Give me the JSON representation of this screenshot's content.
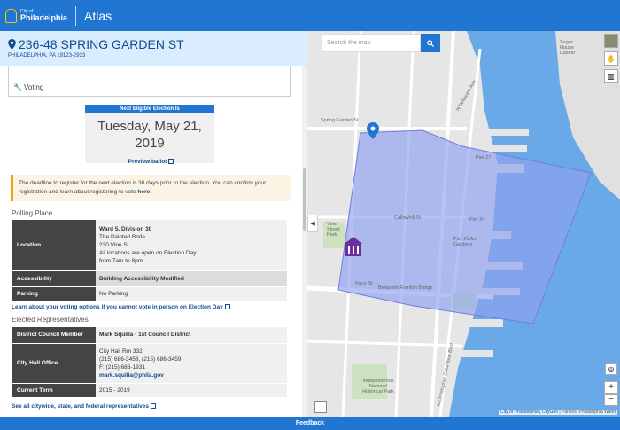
{
  "header": {
    "logo_small": "City of",
    "logo_big": "Philadelphia",
    "app_name": "Atlas"
  },
  "address": {
    "title": "236-48 SPRING GARDEN ST",
    "subtitle": "PHILADELPHIA, PA 19123-2923"
  },
  "voting": {
    "tab_label": "Voting"
  },
  "election": {
    "header": "Next Eligible Election Is",
    "date_line1": "Tuesday, May 21,",
    "date_line2": "2019",
    "preview_link": "Preview ballot"
  },
  "callout": {
    "text": "The deadline to register for the next election is 30 days prior to the election. You can confirm your registration and learn about registering to vote",
    "link": "here",
    "end": "."
  },
  "polling": {
    "title": "Polling Place",
    "location_label": "Location",
    "ward": "Ward 5, Division 30",
    "place": "The Painted Bride",
    "street": "230 Vine St",
    "hours1": "All locations are open on Election Day",
    "hours2": "from 7am to 8pm.",
    "accessibility_label": "Accessibility",
    "accessibility_value": "Building Accessibility Modified",
    "parking_label": "Parking",
    "parking_value": "No Parking",
    "options_link": "Learn about your voting options if you cannot vote in person on Election Day"
  },
  "reps": {
    "title": "Elected Representatives",
    "council_label": "District Council Member",
    "council_value": "Mark Squilla - 1st Council District",
    "office_label": "City Hall Office",
    "office_line1": "City Hall Rm 332",
    "office_line2": "(215) 686-3458, (215) 686-3459",
    "office_line3": "F: (215) 686-1931",
    "office_email": "mark.squilla@phila.gov",
    "term_label": "Current Term",
    "term_value": "2015 - 2019",
    "all_link": "See all citywide, state, and federal representatives"
  },
  "map": {
    "search_placeholder": "Search the map",
    "attribution_city": "City of Philadelphia",
    "attribution_sep": " | ",
    "attribution_cityGeo": "CityGeo",
    "attribution_rest": " | Parcels: Philadelphia Water",
    "zoom_in": "+",
    "zoom_out": "−",
    "labels": {
      "spring_garden": "Spring Garden St",
      "vine": "Vine Street Park",
      "benfranklin": "Benjamin Franklin Bridge",
      "callowhill": "Callowhill St",
      "pier24": "Pier 24",
      "pier25": "Pier 25 Art Gardens",
      "pier27": "Pier 27",
      "independence": "Independence National Historical Park",
      "sugarhouse": "Sugar House Casino",
      "delaware": "N Delaware Ave",
      "columbus": "N Christopher Columbus Blvd",
      "race": "Race St"
    }
  },
  "footer": {
    "label": "Feedback"
  },
  "colors": {
    "brand": "#2176d2",
    "dark": "#0f4d90",
    "address_bg": "#daedfe",
    "water": "#6aa9e8",
    "polygon": "#8fa2f0"
  }
}
